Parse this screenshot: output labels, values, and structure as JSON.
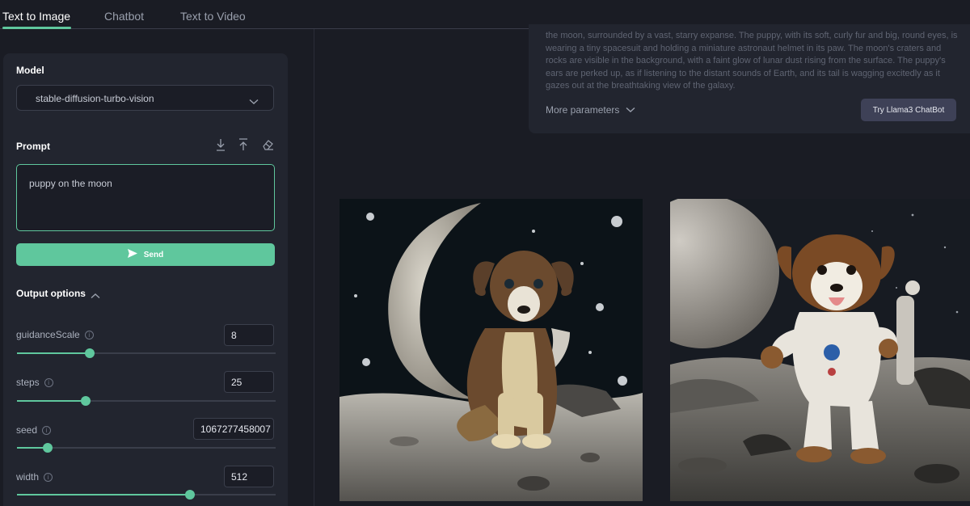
{
  "tabs": [
    {
      "label": "Text to Image",
      "active": true
    },
    {
      "label": "Chatbot",
      "active": false
    },
    {
      "label": "Text to Video",
      "active": false
    }
  ],
  "model": {
    "label": "Model",
    "selected": "stable-diffusion-turbo-vision"
  },
  "prompt": {
    "label": "Prompt",
    "value": "puppy on the moon"
  },
  "send_label": "Send",
  "output_options": {
    "label": "Output options",
    "params": [
      {
        "name": "guidanceScale",
        "value": "8",
        "fill": 0.28
      },
      {
        "name": "steps",
        "value": "25",
        "fill": 0.265
      },
      {
        "name": "seed",
        "value": "1067277458007",
        "fill": 0.12
      },
      {
        "name": "width",
        "value": "512",
        "fill": 0.67
      }
    ]
  },
  "description": "the moon, surrounded by a vast, starry expanse. The puppy, with its soft, curly fur and big, round eyes, is wearing a tiny spacesuit and holding a miniature astronaut helmet in its paw. The moon's craters and rocks are visible in the background, with a faint glow of lunar dust rising from the surface. The puppy's ears are perked up, as if listening to the distant sounds of Earth, and its tail is wagging excitedly as it gazes out at the breathtaking view of the galaxy.",
  "more_parameters_label": "More parameters",
  "try_button_label": "Try Llama3 ChatBot",
  "colors": {
    "accent": "#5fc79d",
    "background": "#1a1c24",
    "panel": "#22252f"
  },
  "icons": [
    "download-icon",
    "upload-icon",
    "eraser-icon",
    "send-icon",
    "chevron-down-icon",
    "chevron-up-icon",
    "info-icon"
  ]
}
